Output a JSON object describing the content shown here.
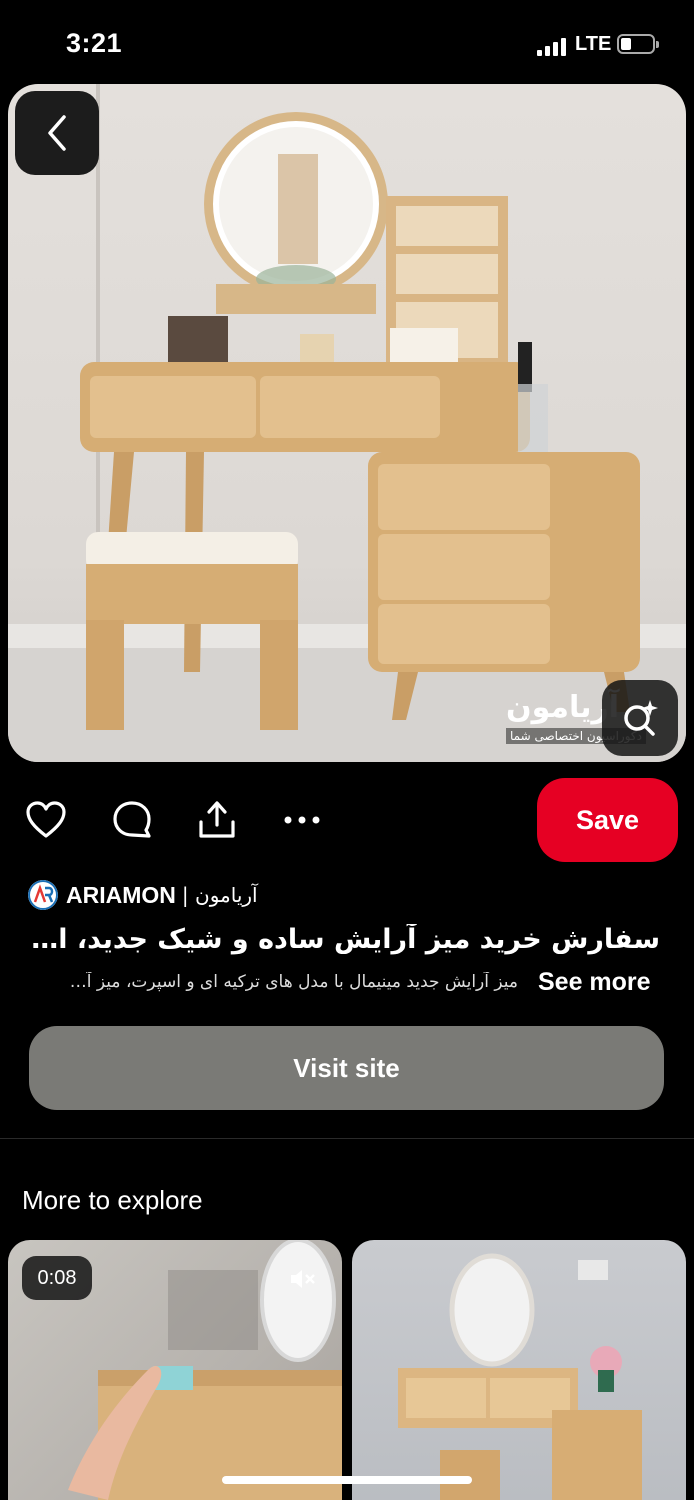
{
  "status_bar": {
    "time": "3:21",
    "network": "LTE"
  },
  "pin": {
    "watermark": "آریامون",
    "watermark_sub": "دکوراسیون اختصاصی شما",
    "save_label": "Save",
    "creator": {
      "name": "ARIAMON",
      "name_fa": "| آریامون"
    },
    "title": "سفارش خرید میز آرایش ساده و شیک جدید، اسپرت…",
    "description": "میز آرایش جدید مینیمال با مدل های ترکیه ای و اسپرت، میز آ…",
    "see_more": "See more",
    "visit_label": "Visit site"
  },
  "explore": {
    "title": "More to explore",
    "cards": [
      {
        "duration": "0:08"
      }
    ]
  },
  "icons": [
    "back-icon",
    "visual-search-icon",
    "heart-icon",
    "comment-icon",
    "share-icon",
    "more-icon",
    "mute-icon"
  ],
  "colors": {
    "save": "#e60023",
    "visit": "#7a7a76",
    "background": "#000000"
  }
}
